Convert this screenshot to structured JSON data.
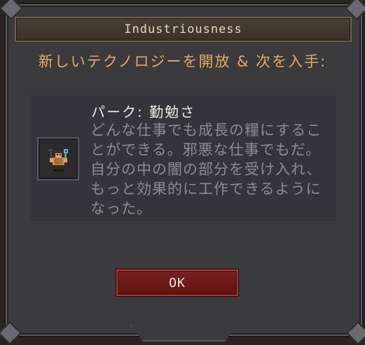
{
  "dialog": {
    "title": "Industriousness",
    "headline": "新しいテクノロジーを開放 & 次を入手:",
    "perk": {
      "title": "パーク: 勤勉さ",
      "description": "どんな仕事でも成長の糧にすることができる。邪悪な仕事でもだ。自分の中の闇の部分を受け入れ、もっと効果的に工作できるようになった。",
      "icon": "worker-with-tools-icon"
    },
    "ok_label": "OK"
  },
  "colors": {
    "headline": "#e3ab62",
    "button": "#6e1b1b",
    "frame": "#3b3a3d"
  }
}
